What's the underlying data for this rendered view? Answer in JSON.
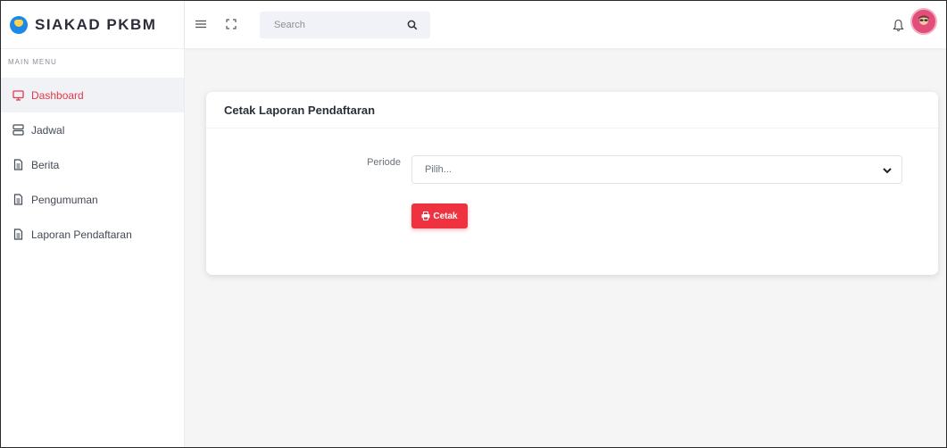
{
  "app": {
    "brand": "SIAKAD PKBM"
  },
  "sidebar": {
    "section_title": "MAIN MENU",
    "items": [
      {
        "label": "Dashboard",
        "icon": "monitor-icon",
        "active": true
      },
      {
        "label": "Jadwal",
        "icon": "server-icon",
        "active": false
      },
      {
        "label": "Berita",
        "icon": "file-icon",
        "active": false
      },
      {
        "label": "Pengumuman",
        "icon": "file-icon",
        "active": false
      },
      {
        "label": "Laporan Pendaftaran",
        "icon": "file-icon",
        "active": false
      }
    ]
  },
  "topbar": {
    "search_placeholder": "Search",
    "icons": [
      "menu-icon",
      "fullscreen-icon",
      "search-icon",
      "bell-icon",
      "avatar"
    ]
  },
  "card": {
    "title": "Cetak Laporan Pendaftaran",
    "periode_label": "Periode",
    "periode_value": "Pilih...",
    "button_label": "Cetak"
  },
  "colors": {
    "accent": "#ef3240",
    "active_text": "#e8394a",
    "background": "#f5f5f6"
  }
}
